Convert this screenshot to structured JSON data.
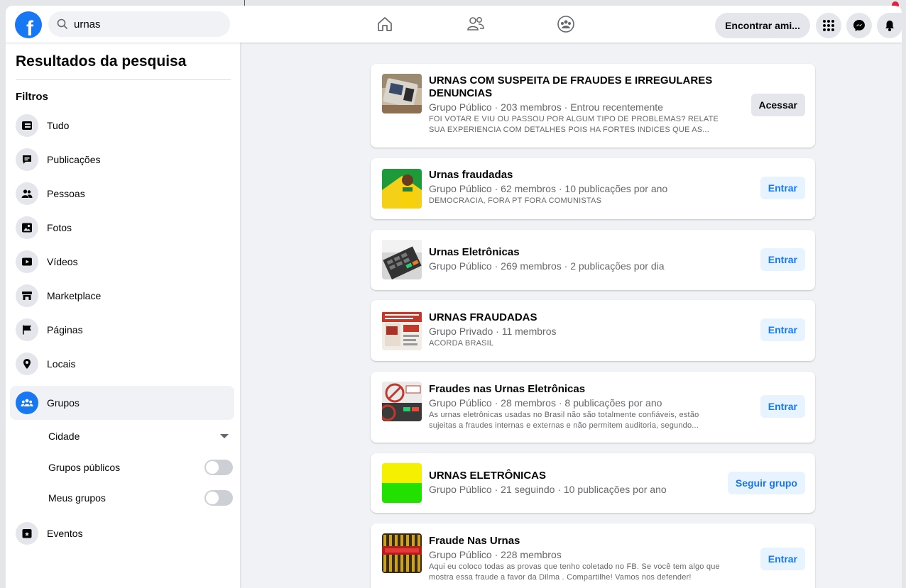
{
  "search": {
    "value": "urnas"
  },
  "header": {
    "find_friends": "Encontrar ami..."
  },
  "sidebar": {
    "title": "Resultados da pesquisa",
    "filters_label": "Filtros",
    "items": [
      {
        "label": "Tudo",
        "icon": "feed-icon"
      },
      {
        "label": "Publicações",
        "icon": "posts-icon"
      },
      {
        "label": "Pessoas",
        "icon": "people-icon"
      },
      {
        "label": "Fotos",
        "icon": "photos-icon"
      },
      {
        "label": "Vídeos",
        "icon": "video-icon"
      },
      {
        "label": "Marketplace",
        "icon": "marketplace-icon"
      },
      {
        "label": "Páginas",
        "icon": "flag-icon"
      },
      {
        "label": "Locais",
        "icon": "location-icon"
      },
      {
        "label": "Grupos",
        "icon": "groups-icon",
        "active": true
      },
      {
        "label": "Eventos",
        "icon": "calendar-icon"
      }
    ],
    "sub": {
      "city": "Cidade",
      "public_groups": "Grupos públicos",
      "my_groups": "Meus grupos"
    }
  },
  "results": [
    {
      "title": "URNAS COM SUSPEITA DE FRAUDES E IRREGULARES DENUNCIAS",
      "meta": "Grupo Público · 203 membros · Entrou recentemente",
      "desc1": "FOI VOTAR E VIU OU PASSOU POR ALGUM TIPO DE PROBLEMAS? RELATE",
      "desc2": "SUA EXPERIENCIA COM DETALHES POIS HA FORTES INDICES QUE AS...",
      "button": "Acessar"
    },
    {
      "title": "Urnas fraudadas",
      "meta": "Grupo Público · 62 membros · 10 publicações por ano",
      "desc1": "DEMOCRACIA, FORA PT FORA COMUNISTAS",
      "button": "Entrar"
    },
    {
      "title": "Urnas Eletrônicas",
      "meta": "Grupo Público · 269 membros · 2 publicações por dia",
      "button": "Entrar"
    },
    {
      "title": "URNAS FRAUDADAS",
      "meta": "Grupo Privado · 11 membros",
      "desc1": "ACORDA BRASIL",
      "button": "Entrar"
    },
    {
      "title": "Fraudes nas Urnas Eletrônicas",
      "meta": "Grupo Público · 28 membros · 8 publicações por ano",
      "desc1": "As urnas eletrônicas usadas no Brasil não são totalmente confiáveis, estão",
      "desc2": "sujeitas a fraudes internas e externas e não permitem auditoria, segundo...",
      "button": "Entrar"
    },
    {
      "title": "URNAS ELETRÔNICAS",
      "meta": "Grupo Público · 21 seguindo · 10 publicações por ano",
      "button": "Seguir grupo"
    },
    {
      "title": "Fraude Nas Urnas",
      "meta": "Grupo Público · 228 membros",
      "desc1": "Aqui eu coloco todas as provas que tenho coletado no FB. Se você tem algo que",
      "desc2": "mostra essa fraude a favor da Dilma . Compartilhe! Vamos nos defender!",
      "button": "Entrar"
    }
  ],
  "colors": {
    "accent": "#1877f2",
    "notification": "#e41e3f"
  }
}
